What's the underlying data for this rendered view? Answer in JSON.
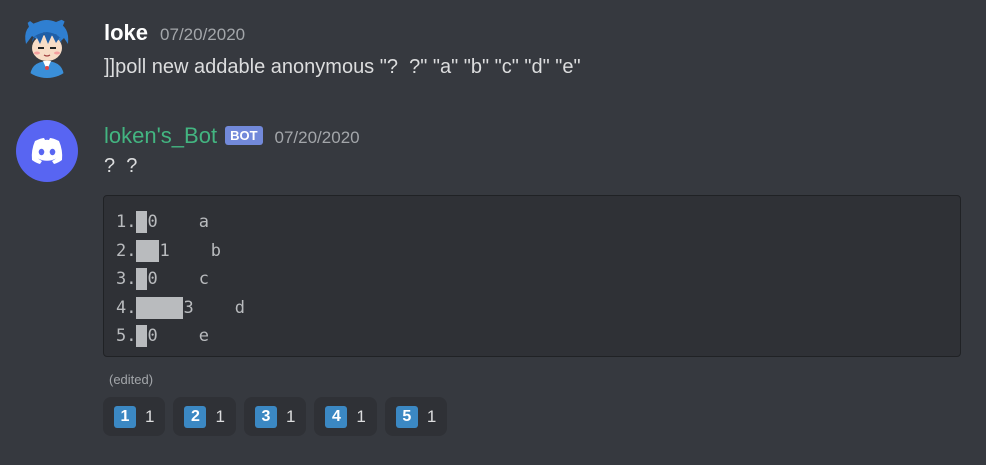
{
  "messages": [
    {
      "username": "loke",
      "timestamp": "07/20/2020",
      "content": "]]poll new addable anonymous \"?  ?\" \"a\" \"b\" \"c\" \"d\" \"e\""
    },
    {
      "username": "loken's_Bot",
      "bot_tag": "BOT",
      "timestamp": "07/20/2020",
      "content": "?  ?",
      "edited": "(edited)"
    }
  ],
  "poll": {
    "lines": [
      {
        "prefix": "1.",
        "bar_units": 1,
        "count": "0",
        "label": "a"
      },
      {
        "prefix": "2.",
        "bar_units": 2,
        "count": "1",
        "label": "b"
      },
      {
        "prefix": "3.",
        "bar_units": 1,
        "count": "0",
        "label": "c"
      },
      {
        "prefix": "4.",
        "bar_units": 4,
        "count": "3",
        "label": "d"
      },
      {
        "prefix": "5.",
        "bar_units": 1,
        "count": "0",
        "label": "e"
      }
    ]
  },
  "reactions": [
    {
      "emoji": "1",
      "count": "1"
    },
    {
      "emoji": "2",
      "count": "1"
    },
    {
      "emoji": "3",
      "count": "1"
    },
    {
      "emoji": "4",
      "count": "1"
    },
    {
      "emoji": "5",
      "count": "1"
    }
  ],
  "colors": {
    "background": "#36393f",
    "bot_name": "#43b581",
    "bot_tag": "#7289da",
    "discord_blurple": "#5865f2",
    "keycap": "#3b88c3"
  },
  "icons": {
    "user_avatar": "anime-character-avatar",
    "bot_avatar": "discord-logo-icon"
  }
}
